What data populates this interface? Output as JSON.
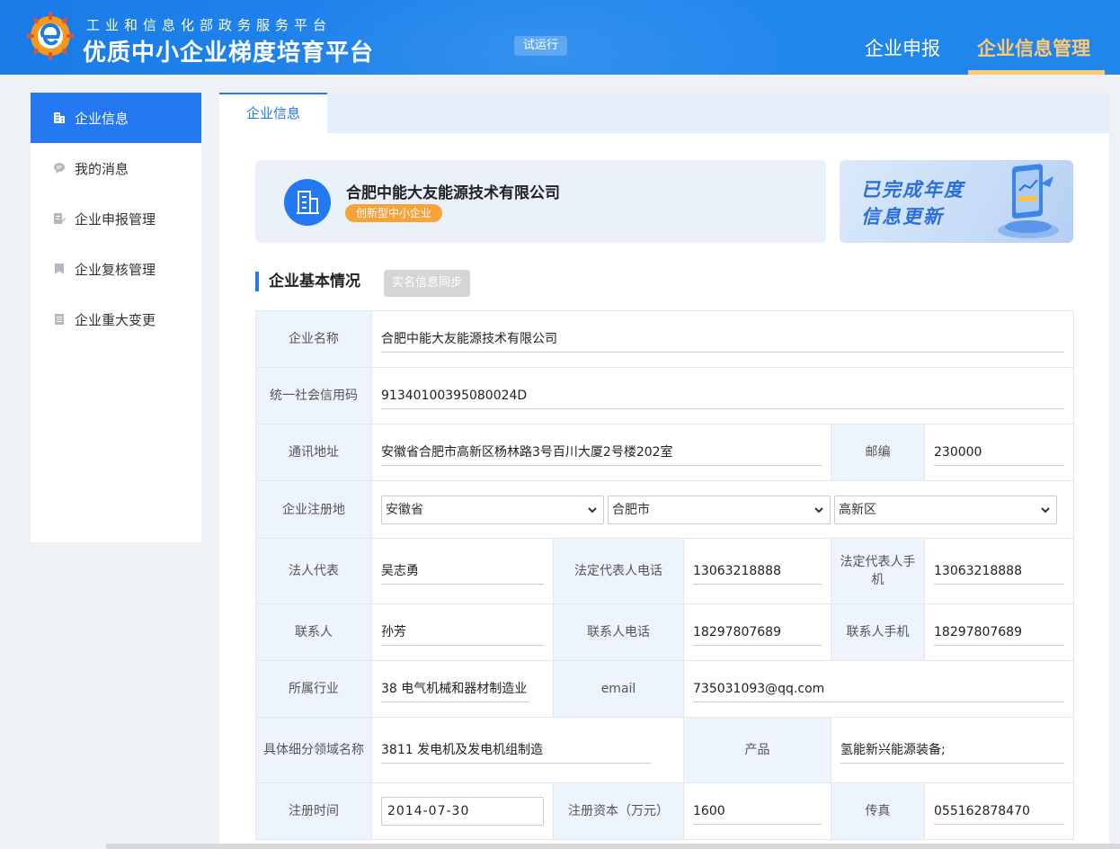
{
  "header": {
    "subtitle": "工业和信息化部政务服务平台",
    "title": "优质中小企业梯度培育平台",
    "trial_badge": "试运行",
    "nav": {
      "report": "企业申报",
      "info": "企业信息管理"
    }
  },
  "sidebar": {
    "items": [
      {
        "label": "企业信息",
        "icon": "building-icon",
        "active": true
      },
      {
        "label": "我的消息",
        "icon": "message-icon"
      },
      {
        "label": "企业申报管理",
        "icon": "edit-doc-icon"
      },
      {
        "label": "企业复核管理",
        "icon": "bookmark-icon"
      },
      {
        "label": "企业重大变更",
        "icon": "document-icon"
      }
    ]
  },
  "main": {
    "tab": "企业信息",
    "company": {
      "name": "合肥中能大友能源技术有限公司",
      "tag": "创新型中小企业"
    },
    "annual": {
      "line1": "已完成年度",
      "line2": "信息更新"
    },
    "section_title": "企业基本情况",
    "sync_button": "实名信息同步",
    "form": {
      "company_name_label": "企业名称",
      "company_name": "合肥中能大友能源技术有限公司",
      "credit_code_label": "统一社会信用码",
      "credit_code": "91340100395080024D",
      "address_label": "通讯地址",
      "address": "安徽省合肥市高新区杨林路3号百川大厦2号楼202室",
      "postcode_label": "邮编",
      "postcode": "230000",
      "reg_place_label": "企业注册地",
      "province": "安徽省",
      "city": "合肥市",
      "district": "高新区",
      "legal_rep_label": "法人代表",
      "legal_rep": "吴志勇",
      "legal_phone_label": "法定代表人电话",
      "legal_phone": "13063218888",
      "legal_mobile_label": "法定代表人手机",
      "legal_mobile": "13063218888",
      "contact_label": "联系人",
      "contact": "孙芳",
      "contact_phone_label": "联系人电话",
      "contact_phone": "18297807689",
      "contact_mobile_label": "联系人手机",
      "contact_mobile": "18297807689",
      "industry_label": "所属行业",
      "industry": "38 电气机械和器材制造业",
      "email_label": "email",
      "email": "735031093@qq.com",
      "subfield_label": "具体细分领域名称",
      "subfield": "3811 发电机及发电机组制造",
      "product_label": "产品",
      "product": "氢能新兴能源装备;",
      "reg_date_label": "注册时间",
      "reg_date": "2014-07-30",
      "capital_label": "注册资本（万元）",
      "capital": "1600",
      "fax_label": "传真",
      "fax": "055162878470"
    }
  },
  "colors": {
    "primary": "#2478f2",
    "header": "#1f82ea",
    "accent": "#ffc973",
    "tag": "#f6a33a"
  }
}
